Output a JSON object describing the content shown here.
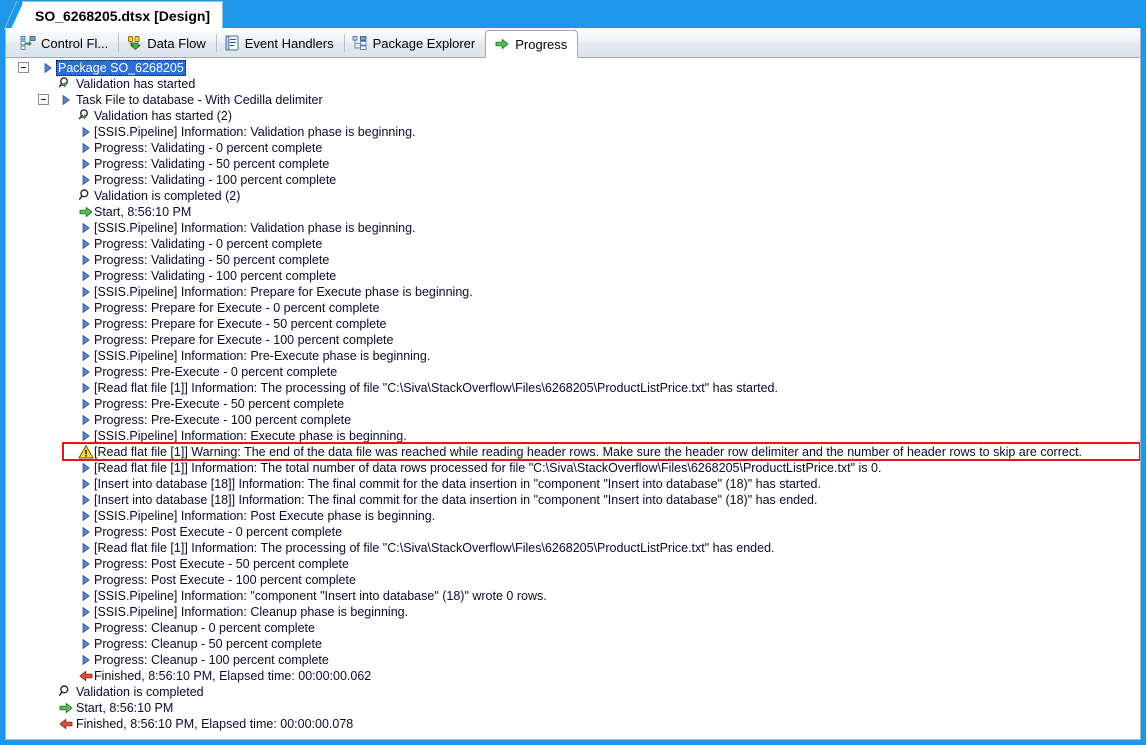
{
  "window": {
    "document_tab_title": "SO_6268205.dtsx [Design]",
    "border_color": "#1c97ea"
  },
  "designer_tabs": [
    {
      "label": "Control Fl...",
      "icon": "control-flow-icon",
      "active": false
    },
    {
      "label": "Data Flow",
      "icon": "data-flow-icon",
      "active": false
    },
    {
      "label": "Event Handlers",
      "icon": "event-handlers-icon",
      "active": false
    },
    {
      "label": "Package Explorer",
      "icon": "package-explorer-icon",
      "active": false
    },
    {
      "label": "Progress",
      "icon": "progress-arrow-icon",
      "active": true
    }
  ],
  "progress_tree": {
    "warning_highlight_index": 24,
    "rows": [
      {
        "text": "Package SO_6268205",
        "icon": "blue-triangle-icon",
        "indent": 0,
        "expander": true,
        "selected": true
      },
      {
        "text": "Validation has started",
        "icon": "validation-started-icon",
        "indent": 1,
        "expander": false,
        "selected": false
      },
      {
        "text": "Task File to database - With Cedilla delimiter",
        "icon": "blue-triangle-icon",
        "indent": 1,
        "expander": true,
        "selected": false
      },
      {
        "text": "Validation has started (2)",
        "icon": "validation-started-icon",
        "indent": 2,
        "expander": false,
        "selected": false
      },
      {
        "text": "[SSIS.Pipeline] Information: Validation phase is beginning.",
        "icon": "blue-triangle-icon",
        "indent": 2,
        "expander": false,
        "selected": false
      },
      {
        "text": "Progress: Validating - 0 percent complete",
        "icon": "blue-triangle-icon",
        "indent": 2,
        "expander": false,
        "selected": false
      },
      {
        "text": "Progress: Validating - 50 percent complete",
        "icon": "blue-triangle-icon",
        "indent": 2,
        "expander": false,
        "selected": false
      },
      {
        "text": "Progress: Validating - 100 percent complete",
        "icon": "blue-triangle-icon",
        "indent": 2,
        "expander": false,
        "selected": false
      },
      {
        "text": "Validation is completed (2)",
        "icon": "validation-completed-icon",
        "indent": 2,
        "expander": false,
        "selected": false
      },
      {
        "text": "Start, 8:56:10 PM",
        "icon": "start-green-arrow-icon",
        "indent": 2,
        "expander": false,
        "selected": false
      },
      {
        "text": "[SSIS.Pipeline] Information: Validation phase is beginning.",
        "icon": "blue-triangle-icon",
        "indent": 2,
        "expander": false,
        "selected": false
      },
      {
        "text": "Progress: Validating - 0 percent complete",
        "icon": "blue-triangle-icon",
        "indent": 2,
        "expander": false,
        "selected": false
      },
      {
        "text": "Progress: Validating - 50 percent complete",
        "icon": "blue-triangle-icon",
        "indent": 2,
        "expander": false,
        "selected": false
      },
      {
        "text": "Progress: Validating - 100 percent complete",
        "icon": "blue-triangle-icon",
        "indent": 2,
        "expander": false,
        "selected": false
      },
      {
        "text": "[SSIS.Pipeline] Information: Prepare for Execute phase is beginning.",
        "icon": "blue-triangle-icon",
        "indent": 2,
        "expander": false,
        "selected": false
      },
      {
        "text": "Progress: Prepare for Execute - 0 percent complete",
        "icon": "blue-triangle-icon",
        "indent": 2,
        "expander": false,
        "selected": false
      },
      {
        "text": "Progress: Prepare for Execute - 50 percent complete",
        "icon": "blue-triangle-icon",
        "indent": 2,
        "expander": false,
        "selected": false
      },
      {
        "text": "Progress: Prepare for Execute - 100 percent complete",
        "icon": "blue-triangle-icon",
        "indent": 2,
        "expander": false,
        "selected": false
      },
      {
        "text": "[SSIS.Pipeline] Information: Pre-Execute phase is beginning.",
        "icon": "blue-triangle-icon",
        "indent": 2,
        "expander": false,
        "selected": false
      },
      {
        "text": "Progress: Pre-Execute - 0 percent complete",
        "icon": "blue-triangle-icon",
        "indent": 2,
        "expander": false,
        "selected": false
      },
      {
        "text": "[Read flat file [1]] Information: The processing of file \"C:\\Siva\\StackOverflow\\Files\\6268205\\ProductListPrice.txt\" has started.",
        "icon": "blue-triangle-icon",
        "indent": 2,
        "expander": false,
        "selected": false
      },
      {
        "text": "Progress: Pre-Execute - 50 percent complete",
        "icon": "blue-triangle-icon",
        "indent": 2,
        "expander": false,
        "selected": false
      },
      {
        "text": "Progress: Pre-Execute - 100 percent complete",
        "icon": "blue-triangle-icon",
        "indent": 2,
        "expander": false,
        "selected": false
      },
      {
        "text": "[SSIS.Pipeline] Information: Execute phase is beginning.",
        "icon": "blue-triangle-icon",
        "indent": 2,
        "expander": false,
        "selected": false
      },
      {
        "text": "[Read flat file [1]] Warning: The end of the data file was reached while reading header rows. Make sure the header row delimiter and the number of header rows to skip are correct.",
        "icon": "warning-triangle-icon",
        "indent": 2,
        "expander": false,
        "selected": false
      },
      {
        "text": "[Read flat file [1]] Information: The total number of data rows processed for file \"C:\\Siva\\StackOverflow\\Files\\6268205\\ProductListPrice.txt\" is 0.",
        "icon": "blue-triangle-icon",
        "indent": 2,
        "expander": false,
        "selected": false
      },
      {
        "text": "[Insert into database [18]] Information: The final commit for the data insertion in \"component \"Insert into database\" (18)\" has started.",
        "icon": "blue-triangle-icon",
        "indent": 2,
        "expander": false,
        "selected": false
      },
      {
        "text": "[Insert into database [18]] Information: The final commit for the data insertion  in \"component \"Insert into database\" (18)\" has ended.",
        "icon": "blue-triangle-icon",
        "indent": 2,
        "expander": false,
        "selected": false
      },
      {
        "text": "[SSIS.Pipeline] Information: Post Execute phase is beginning.",
        "icon": "blue-triangle-icon",
        "indent": 2,
        "expander": false,
        "selected": false
      },
      {
        "text": "Progress: Post Execute - 0 percent complete",
        "icon": "blue-triangle-icon",
        "indent": 2,
        "expander": false,
        "selected": false
      },
      {
        "text": "[Read flat file [1]] Information: The processing of file \"C:\\Siva\\StackOverflow\\Files\\6268205\\ProductListPrice.txt\" has ended.",
        "icon": "blue-triangle-icon",
        "indent": 2,
        "expander": false,
        "selected": false
      },
      {
        "text": "Progress: Post Execute - 50 percent complete",
        "icon": "blue-triangle-icon",
        "indent": 2,
        "expander": false,
        "selected": false
      },
      {
        "text": "Progress: Post Execute - 100 percent complete",
        "icon": "blue-triangle-icon",
        "indent": 2,
        "expander": false,
        "selected": false
      },
      {
        "text": "[SSIS.Pipeline] Information: \"component \"Insert into database\" (18)\" wrote 0 rows.",
        "icon": "blue-triangle-icon",
        "indent": 2,
        "expander": false,
        "selected": false
      },
      {
        "text": "[SSIS.Pipeline] Information: Cleanup phase is beginning.",
        "icon": "blue-triangle-icon",
        "indent": 2,
        "expander": false,
        "selected": false
      },
      {
        "text": "Progress: Cleanup - 0 percent complete",
        "icon": "blue-triangle-icon",
        "indent": 2,
        "expander": false,
        "selected": false
      },
      {
        "text": "Progress: Cleanup - 50 percent complete",
        "icon": "blue-triangle-icon",
        "indent": 2,
        "expander": false,
        "selected": false
      },
      {
        "text": "Progress: Cleanup - 100 percent complete",
        "icon": "blue-triangle-icon",
        "indent": 2,
        "expander": false,
        "selected": false
      },
      {
        "text": "Finished, 8:56:10 PM, Elapsed time: 00:00:00.062",
        "icon": "finished-red-arrow-icon",
        "indent": 2,
        "expander": false,
        "selected": false
      },
      {
        "text": "Validation is completed",
        "icon": "validation-completed-icon",
        "indent": 1,
        "expander": false,
        "selected": false
      },
      {
        "text": "Start, 8:56:10 PM",
        "icon": "start-green-arrow-icon",
        "indent": 1,
        "expander": false,
        "selected": false
      },
      {
        "text": "Finished, 8:56:10 PM, Elapsed time: 00:00:00.078",
        "icon": "finished-red-arrow-icon",
        "indent": 1,
        "expander": false,
        "selected": false
      }
    ]
  },
  "colors": {
    "selection_blue": "#2a6fd4",
    "warning_outline_red": "#e81515",
    "window_border_blue": "#1c97ea",
    "tree_text": "#0b0b2b"
  }
}
